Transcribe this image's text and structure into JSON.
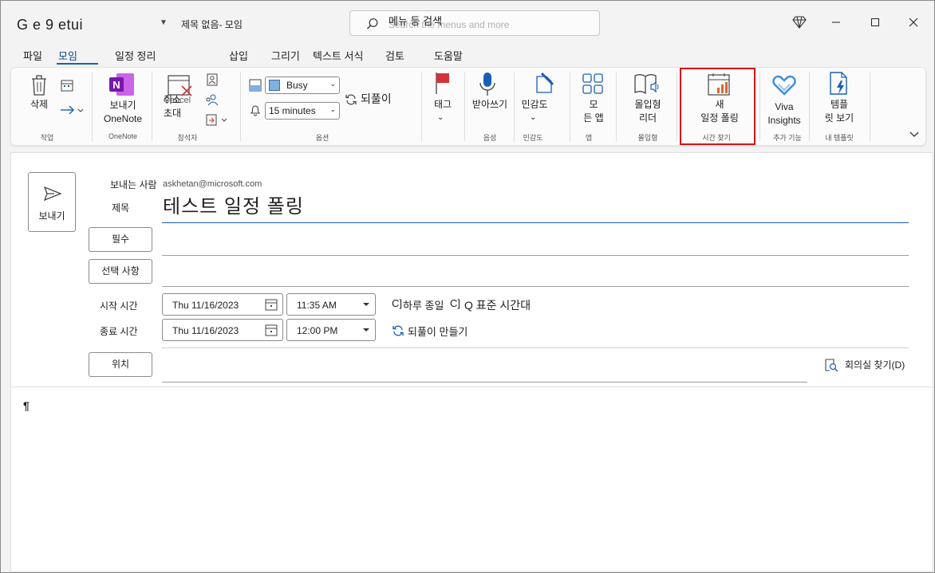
{
  "app_title": "G e 9 etui",
  "document_title": "제목 없음- 모임",
  "search": {
    "label": "메뉴 등 검색",
    "placeholder": "Search the menus and more"
  },
  "menu_tabs": [
    "파일",
    "모임",
    "일정 정리",
    "삽입",
    "그리기",
    "텍스트 서식",
    "검토",
    "도움말"
  ],
  "active_tab": "모임",
  "ribbon": {
    "delete_label": "삭제",
    "onenote_label_1": "보내기",
    "onenote_label_2": "OneNote",
    "cancel_label_1": "취소",
    "cancel_label_2": "초대",
    "cancel_overlay": "Cancel",
    "busy_value": "Busy",
    "reminder_value": "15 minutes",
    "recurrence_label": "되풀이",
    "tag_label": "태그",
    "dictate_label": "받아쓰기",
    "sensitivity_label": "민감도",
    "apps_label_1": "모",
    "apps_label_2": "든 앱",
    "immersive_label_1": "몰입형",
    "immersive_label_2": "리더",
    "new_poll_label_1": "새",
    "new_poll_label_2": "일정 폴링",
    "viva_label_1": "Viva",
    "viva_label_2": "Insights",
    "templates_label_1": "템플",
    "templates_label_2": "릿 보기",
    "groups": {
      "actions": "작업",
      "onenote": "OneNote",
      "attendees": "참석자",
      "options": "옵션",
      "voice": "음성",
      "sensitivity": "민감도",
      "apps": "앱",
      "immersive": "몰입형",
      "find_time": "시간 찾기",
      "addins": "추가 기능",
      "my_templates": "내 템플릿"
    }
  },
  "compose": {
    "send_label": "보내기",
    "from_label": "보내는 사람",
    "from_value": "askhetan@microsoft.com",
    "subject_label": "제목",
    "subject_value": "테스트 일정 폴링",
    "required_label": "필수",
    "optional_label": "선택 사항",
    "start_label": "시작 시간",
    "end_label": "종료 시간",
    "start_date": "Thu 11/16/2023",
    "start_time": "11:35 AM",
    "end_date": "Thu 11/16/2023",
    "end_time": "12:00 PM",
    "all_day_label": "하루 종일",
    "all_day_prefix": "C]",
    "timezone_prefix": "C]",
    "timezone_label": "Q 표준 시간대",
    "make_recurring_label": "되풀이 만들기",
    "location_label": "위치",
    "room_finder_label": "회의실 찾기(D)",
    "body_mark": "¶"
  },
  "colors": {
    "accent": "#1a5fb4",
    "highlight": "#d0161b",
    "onenote": "#7719aa",
    "tag": "#d13438"
  }
}
